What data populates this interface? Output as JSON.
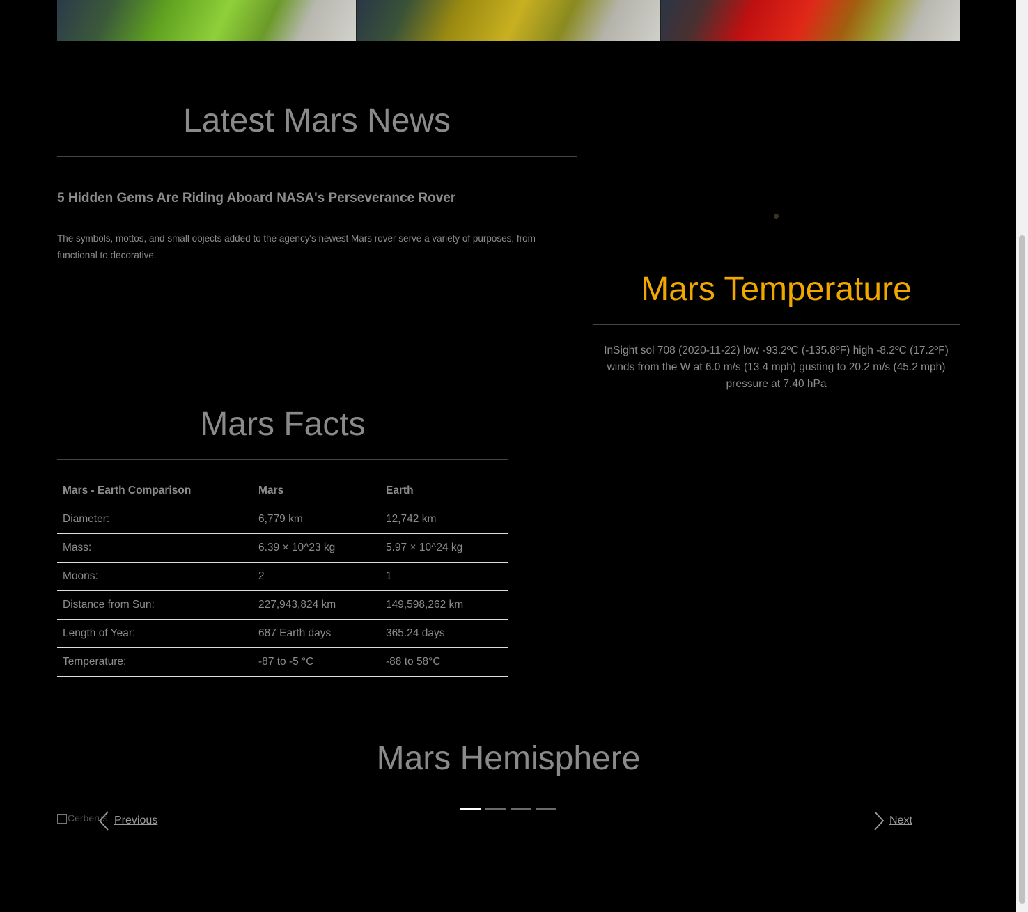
{
  "news": {
    "title": "Latest Mars News",
    "headline": "5 Hidden Gems Are Riding Aboard NASA's Perseverance Rover",
    "teaser": "The symbols, mottos, and small objects added to the agency's newest Mars rover serve a variety of purposes, from functional to decorative."
  },
  "weather": {
    "title": "Mars Temperature",
    "line1": "InSight sol 708 (2020-11-22) low -93.2ºC (-135.8ºF) high -8.2ºC (17.2ºF)",
    "line2": "winds from the W at 6.0 m/s (13.4 mph) gusting to 20.2 m/s (45.2 mph)",
    "line3": "pressure at 7.40 hPa"
  },
  "facts": {
    "title": "Mars Facts",
    "headers": [
      "Mars - Earth Comparison",
      "Mars",
      "Earth"
    ],
    "rows": [
      [
        "Diameter:",
        "6,779 km",
        "12,742 km"
      ],
      [
        "Mass:",
        "6.39 × 10^23 kg",
        "5.97 × 10^24 kg"
      ],
      [
        "Moons:",
        "2",
        "1"
      ],
      [
        "Distance from Sun:",
        "227,943,824 km",
        "149,598,262 km"
      ],
      [
        "Length of Year:",
        "687 Earth days",
        "365.24 days"
      ],
      [
        "Temperature:",
        "-87 to -5 °C",
        "-88 to 58°C"
      ]
    ]
  },
  "hemisphere": {
    "title": "Mars Hemisphere",
    "image_alt": "Cerberus",
    "previous_label": "Previous",
    "next_label": "Next"
  },
  "colors": {
    "background": "#000000",
    "accent": "#f0a800",
    "text": "#8c8c8c"
  }
}
